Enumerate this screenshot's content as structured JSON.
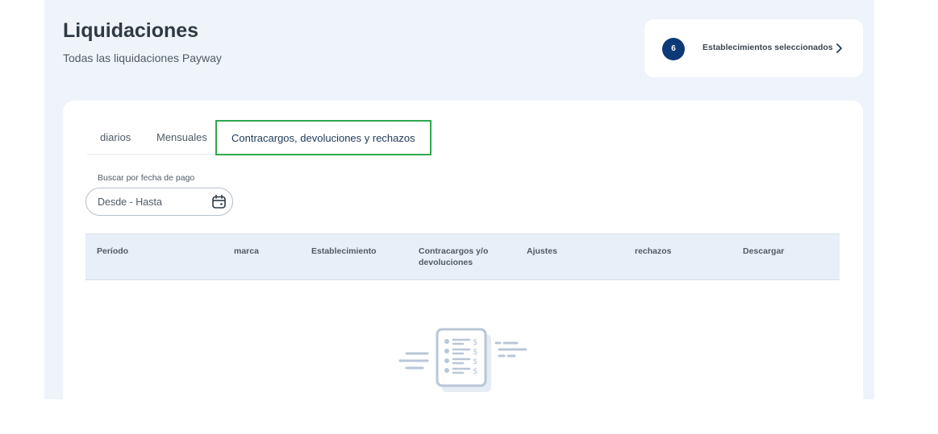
{
  "page": {
    "title": "Liquidaciones",
    "subtitle": "Todas las liquidaciones Payway"
  },
  "establishments": {
    "count": "6",
    "label": "Establecimientos seleccionados"
  },
  "tabs": [
    {
      "label": "diarios",
      "active": false
    },
    {
      "label": "Mensuales",
      "active": false
    },
    {
      "label": "Contracargos, devoluciones y rechazos",
      "active": true
    }
  ],
  "search": {
    "label": "Buscar por fecha de pago",
    "placeholder": "Desde - Hasta"
  },
  "table": {
    "columns": [
      "Período",
      "marca",
      "Establecimiento",
      "Contracargos y/o devoluciones",
      "Ajustes",
      "rechazos",
      "Descargar"
    ]
  },
  "icons": {
    "selector": "chevron-right-icon",
    "date": "calendar-icon",
    "empty_state": "empty-list-illustration"
  },
  "colors": {
    "page_background": "#eff4fb",
    "badge": "#0d3977",
    "active_tab_border": "#2ea84e",
    "table_header": "#e8eff8",
    "illustration": "#b9c6d8"
  }
}
